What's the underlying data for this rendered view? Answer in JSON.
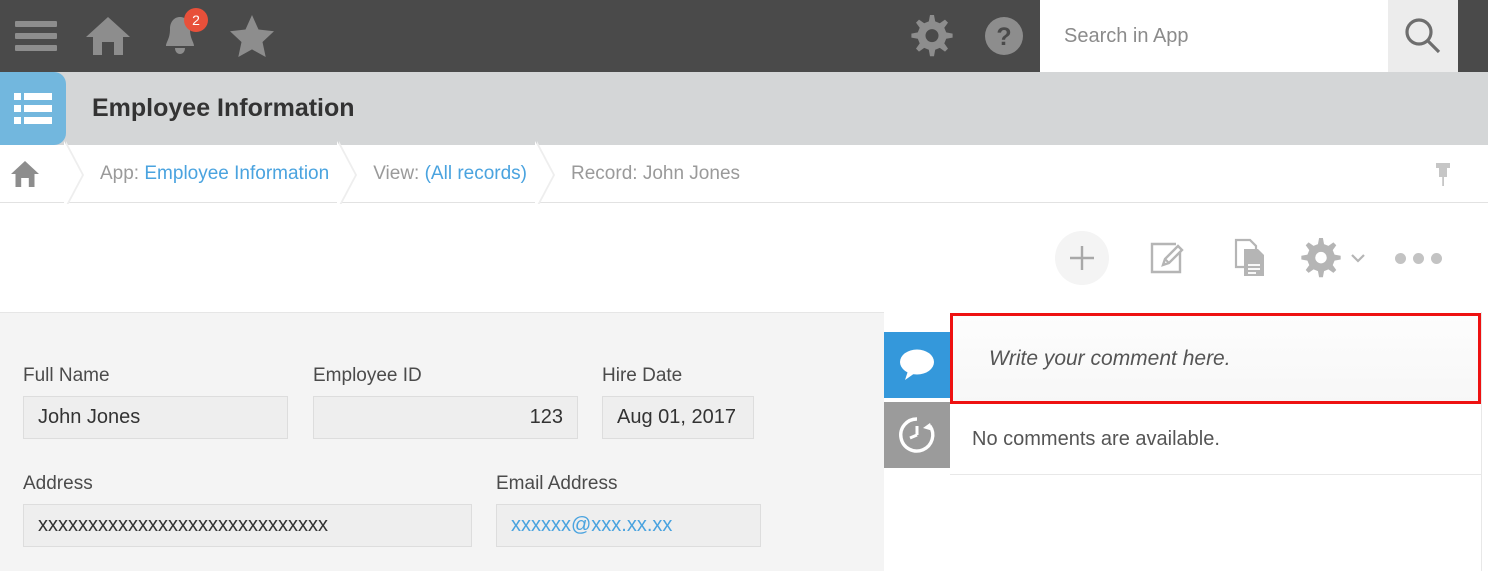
{
  "topbar": {
    "menu_icon": "hamburger-icon",
    "home_icon": "home-icon",
    "notifications_icon": "bell-icon",
    "notifications_count": "2",
    "favorites_icon": "star-icon",
    "settings_icon": "gear-icon",
    "help_icon": "help-icon",
    "search_placeholder": "Search in App",
    "search_value": "",
    "search_icon": "search-icon",
    "badge_color": "#e8503a",
    "background_color": "#4a4a4a"
  },
  "appheader": {
    "icon": "list-app-icon",
    "title": "Employee Information",
    "icon_color": "#72b7de",
    "background_color": "#d4d6d7"
  },
  "breadcrumb": {
    "home_icon": "home-icon",
    "items": [
      {
        "prefix": "App:",
        "link": "Employee Information"
      },
      {
        "prefix": "View:",
        "link": "(All records)"
      },
      {
        "prefix": "Record:",
        "link": "John Jones",
        "plain": true
      }
    ],
    "pin_icon": "pin-icon",
    "link_color": "#4aa3df"
  },
  "toolbar": {
    "actions": [
      {
        "name": "add-record-button",
        "icon": "plus-icon"
      },
      {
        "name": "edit-record-button",
        "icon": "edit-pencil-icon"
      },
      {
        "name": "duplicate-record-button",
        "icon": "copy-documents-icon"
      },
      {
        "name": "settings-menu-button",
        "icon": "gear-icon"
      },
      {
        "name": "more-actions-button",
        "icon": "ellipsis-icon"
      }
    ]
  },
  "form": {
    "fields": [
      {
        "label": "Full Name",
        "value": "John Jones",
        "align": "left",
        "style": "text"
      },
      {
        "label": "Employee ID",
        "value": "123",
        "align": "right",
        "style": "text"
      },
      {
        "label": "Hire Date",
        "value": "Aug 01, 2017",
        "align": "left",
        "style": "text"
      },
      {
        "label": "Address",
        "value": "xxxxxxxxxxxxxxxxxxxxxxxxxxxxx",
        "align": "left",
        "style": "text"
      },
      {
        "label": "Email Address",
        "value": "xxxxxx@xxx.xx.xx",
        "align": "left",
        "style": "link"
      }
    ],
    "background_color": "#f4f4f4"
  },
  "rightpanel": {
    "tabs": [
      {
        "name": "comments-tab",
        "icon": "speech-bubble-icon",
        "state": "active",
        "color": "#3498db"
      },
      {
        "name": "history-tab",
        "icon": "history-clock-icon",
        "state": "idle",
        "color": "#9b9b9b"
      }
    ],
    "comment_placeholder": "Write your comment here.",
    "comment_value": "",
    "empty_message": "No comments are available.",
    "highlight_color": "#ee1111"
  }
}
